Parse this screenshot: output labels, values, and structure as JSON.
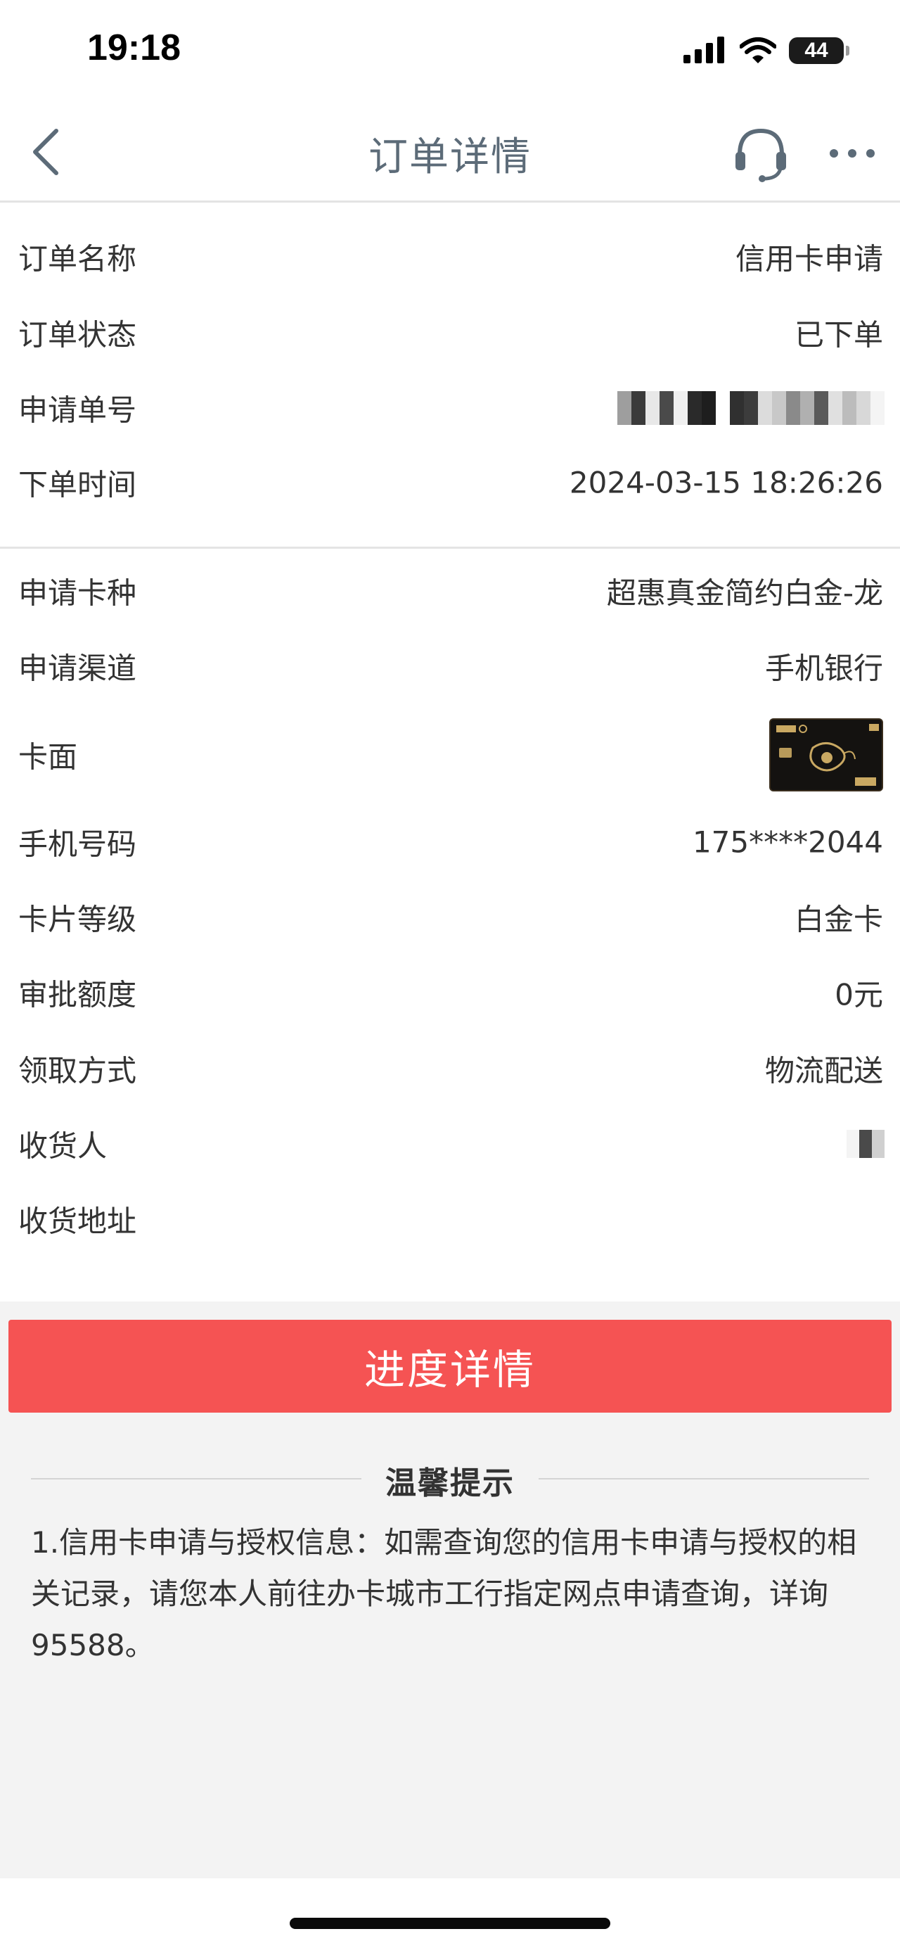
{
  "status_bar": {
    "time": "19:18",
    "battery": "44"
  },
  "nav": {
    "title": "订单详情"
  },
  "order_info": {
    "name_label": "订单名称",
    "name_value": "信用卡申请",
    "status_label": "订单状态",
    "status_value": "已下单",
    "number_label": "申请单号",
    "time_label": "下单时间",
    "time_value": "2024-03-15 18:26:26"
  },
  "card_info": {
    "type_label": "申请卡种",
    "type_value": "超惠真金简约白金-龙",
    "channel_label": "申请渠道",
    "channel_value": "手机银行",
    "face_label": "卡面",
    "phone_label": "手机号码",
    "phone_value": "175****2044",
    "level_label": "卡片等级",
    "level_value": "白金卡",
    "limit_label": "审批额度",
    "limit_value": "0元",
    "delivery_label": "领取方式",
    "delivery_value": "物流配送",
    "receiver_label": "收货人",
    "address_label": "收货地址"
  },
  "progress_button": "进度详情",
  "tips": {
    "title": "温馨提示",
    "text": "1.信用卡申请与授权信息：如需查询您的信用卡申请与授权的相关记录，请您本人前往办卡城市工行指定网点申请查询，详询95588。"
  }
}
